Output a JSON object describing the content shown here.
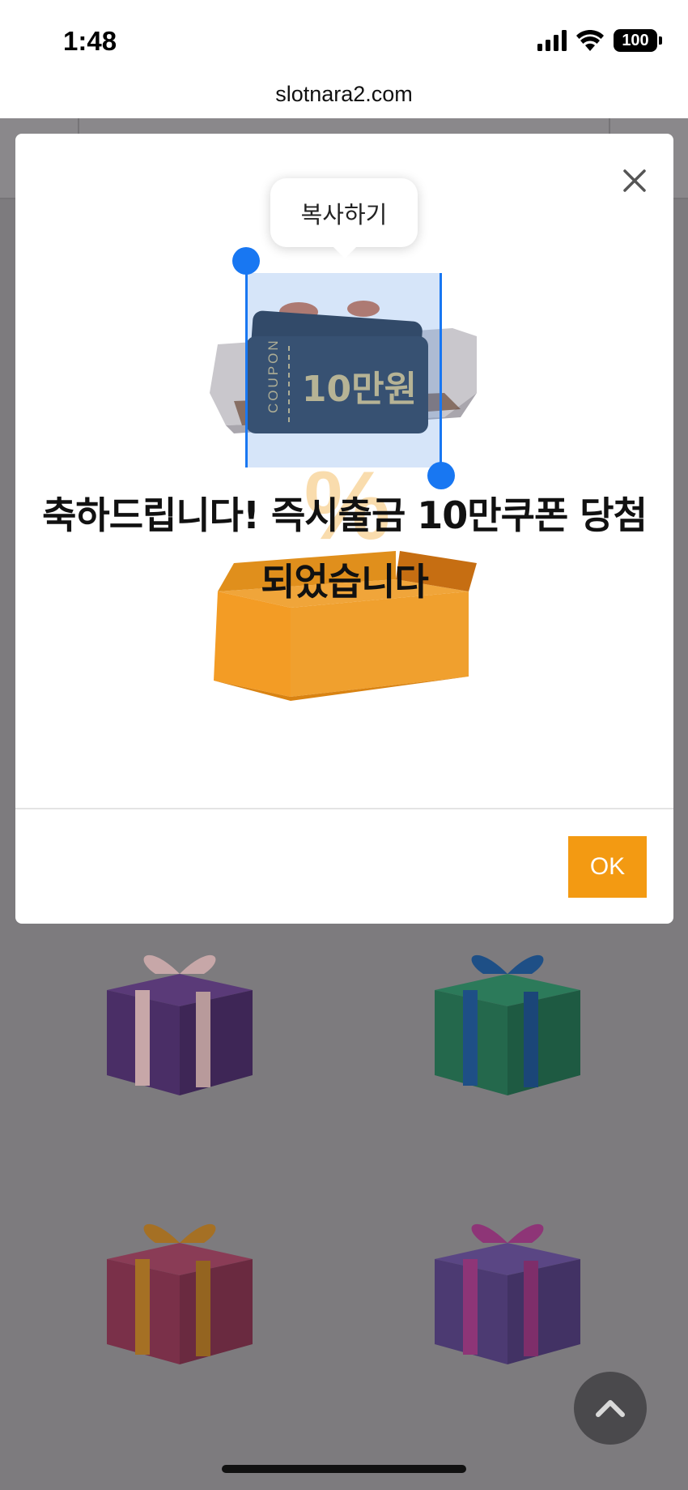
{
  "status": {
    "time": "1:48",
    "battery": "100"
  },
  "browser": {
    "url": "slotnara2.com"
  },
  "modal": {
    "tooltip": "복사하기",
    "coupon_side": "COUPON",
    "coupon_amount": "10만원",
    "headline": "축하드립니다! 즉시출금 10만쿠폰 당첨 되었습니다",
    "ok_label": "OK"
  },
  "icons": [
    "signal-icon",
    "wifi-icon",
    "battery-icon",
    "close-icon",
    "chevron-up-icon"
  ],
  "colors": {
    "accent": "#f39a12",
    "selection": "#1877f2"
  }
}
